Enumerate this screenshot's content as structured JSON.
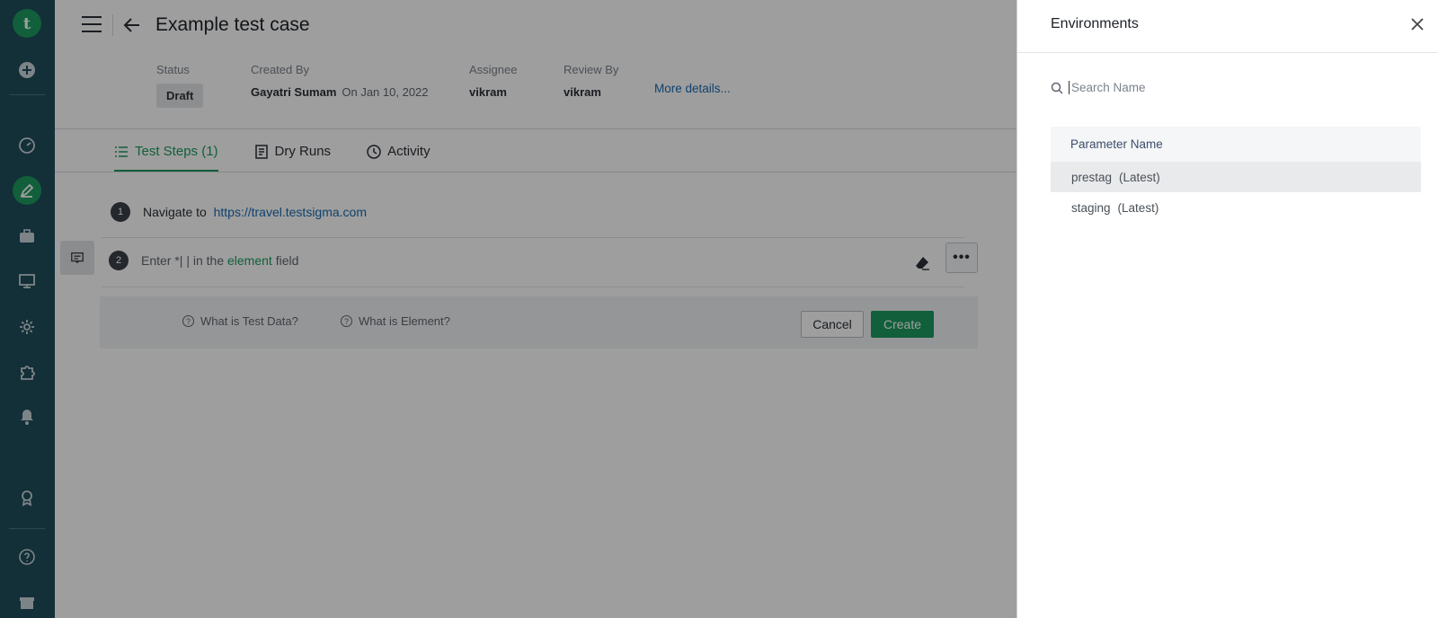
{
  "rail": {
    "logo": "t",
    "items": [
      "add-icon",
      "dashboard-icon",
      "edit-icon",
      "briefcase-icon",
      "monitor-icon",
      "settings-icon",
      "puzzle-icon",
      "bell-icon",
      "award-icon",
      "help-icon",
      "gift-icon"
    ]
  },
  "header": {
    "title": "Example test case",
    "status_label": "Status",
    "status_value": "Draft",
    "created_by_label": "Created By",
    "created_by_value": "Gayatri Sumam",
    "created_on": "On Jan 10, 2022",
    "assignee_label": "Assignee",
    "assignee_value": "vikram",
    "review_label": "Review By",
    "review_value": "vikram",
    "more_details": "More details..."
  },
  "tabs": [
    {
      "label": "Test Steps (1)",
      "active": true
    },
    {
      "label": "Dry Runs",
      "active": false
    },
    {
      "label": "Activity",
      "active": false
    }
  ],
  "steps": [
    {
      "num": "1",
      "text": "Navigate to",
      "url": "https://travel.testsigma.com"
    },
    {
      "num": "2",
      "pre": "Enter *| | in the",
      "element": "element",
      "post": "field"
    }
  ],
  "helpbar": {
    "test_data_help": "What is Test Data?",
    "element_help": "What is Element?",
    "cancel_label": "Cancel",
    "create_label": "Create",
    "dots_label": "•••"
  },
  "drawer": {
    "title": "Environments",
    "search_placeholder": "Search Name",
    "column_header": "Parameter Name",
    "rows": [
      {
        "name": "prestag",
        "tag": "(Latest)",
        "selected": true
      },
      {
        "name": "staging",
        "tag": "(Latest)",
        "selected": false
      }
    ]
  },
  "colors": {
    "rail": "#1f4d5b",
    "accent": "#1e9a5f",
    "link": "#1b6ab0"
  }
}
